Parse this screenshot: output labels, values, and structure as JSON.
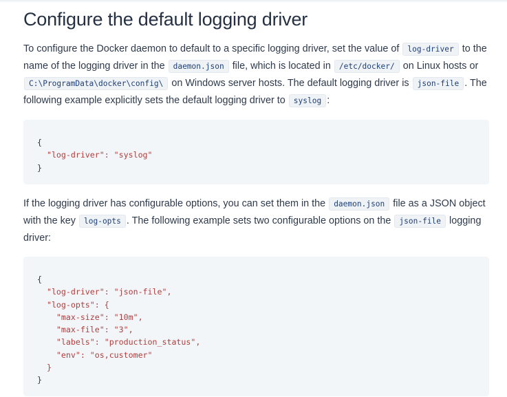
{
  "section": {
    "heading": "Configure the default logging driver"
  },
  "para1": {
    "t1": "To configure the Docker daemon to default to a specific logging driver, set the value of",
    "c1": "log-driver",
    "t2": "to the name of the logging driver in the",
    "c2": "daemon.json",
    "t3": "file, which is located in",
    "c3": "/etc/docker/",
    "t4": "on Linux hosts or",
    "c4": "C:\\ProgramData\\docker\\config\\",
    "t5": "on Windows server hosts. The default logging driver is",
    "c5": "json-file",
    "t6": ". The following example explicitly sets the default logging driver to",
    "c6": "syslog",
    "t7": ":"
  },
  "code1": {
    "lines": [
      "{",
      "  \"log-driver\": \"syslog\"",
      "}"
    ]
  },
  "para2": {
    "t1": "If the logging driver has configurable options, you can set them in the",
    "c1": "daemon.json",
    "t2": "file as a JSON object with the key",
    "c2": "log-opts",
    "t3": ". The following example sets two configurable options on the",
    "c3": "json-file",
    "t4": "logging driver:"
  },
  "code2": {
    "lines": [
      "{",
      "  \"log-driver\": \"json-file\",",
      "  \"log-opts\": {",
      "    \"max-size\": \"10m\",",
      "    \"max-file\": \"3\",",
      "    \"labels\": \"production_status\",",
      "    \"env\": \"os,customer\"",
      "  }",
      "}"
    ]
  }
}
